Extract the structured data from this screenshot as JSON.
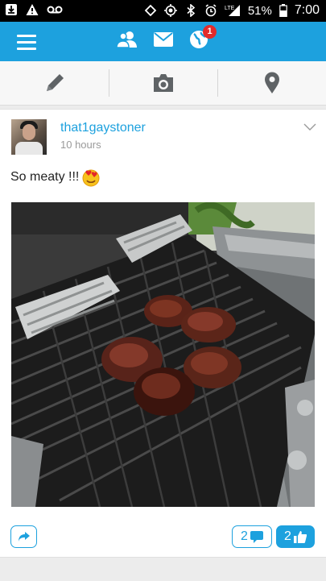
{
  "status_bar": {
    "battery": "51%",
    "time": "7:00",
    "network": "LTE",
    "icons": [
      "download-icon",
      "warning-icon",
      "voicemail-icon",
      "sync-icon",
      "location-target-icon",
      "bluetooth-icon",
      "alarm-icon",
      "signal-icon",
      "battery-icon"
    ]
  },
  "app_bar": {
    "notification_count": "1",
    "icons": [
      "menu-icon",
      "friends-icon",
      "messages-icon",
      "globe-notifications-icon"
    ]
  },
  "compose_toolbar": {
    "icons": [
      "pencil-icon",
      "camera-icon",
      "location-pin-icon"
    ]
  },
  "post": {
    "username": "that1gaystoner",
    "time": "10 hours",
    "text": "So meaty !!!",
    "emoji": "heart-eyes-emoji",
    "image_description_icon": "grill-photo",
    "comment_count": "2",
    "like_count": "2"
  },
  "colors": {
    "accent": "#1da1de",
    "badge": "#e32b2b",
    "status_bar": "#000000"
  }
}
